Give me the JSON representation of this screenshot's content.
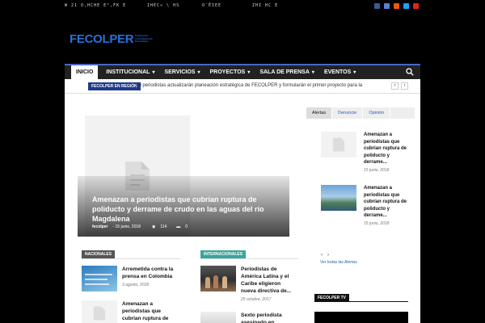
{
  "topbar": {
    "segments": [
      "W 21 O,HCHE E²,FK E",
      "IHEC« \\ HS",
      "O¯ÊIEE",
      "ZHI HC E"
    ]
  },
  "social_icons": [
    {
      "name": "facebook-icon",
      "color": "#3b5998"
    },
    {
      "name": "instagram-icon",
      "color": "#5b7fd1"
    },
    {
      "name": "soundcloud-icon",
      "color": "#ff5500"
    },
    {
      "name": "twitter-icon",
      "color": "#1da1f2"
    },
    {
      "name": "youtube-icon",
      "color": "#e62117"
    }
  ],
  "logo": {
    "word": "FECOLPER",
    "subtitle": "Federación Colombiana de Periodistas"
  },
  "nav": {
    "items": [
      {
        "label": "INICIO",
        "active": true,
        "dropdown": false
      },
      {
        "label": "INSTITUCIONAL",
        "active": false,
        "dropdown": true
      },
      {
        "label": "SERVICIOS",
        "active": false,
        "dropdown": true
      },
      {
        "label": "PROYECTOS",
        "active": false,
        "dropdown": true
      },
      {
        "label": "SALA DE PRENSA",
        "active": false,
        "dropdown": true
      },
      {
        "label": "EVENTOS",
        "active": false,
        "dropdown": true
      }
    ],
    "accent": "#4a66c8"
  },
  "ticker": {
    "badge": "FECOLPER EN REGIÓN",
    "headline": "20 periodistas actualizarán planeación estratégica de FECOLPER y formularán el primer proyecto para la",
    "prev": "‹",
    "next": "›"
  },
  "feature": {
    "title": "Amenazan a periodistas que cubrían ruptura de poliducto y derrame de crudo en las aguas del río Magdalena",
    "author": "fecolper",
    "date": "- 15 junio, 2018",
    "views": "114",
    "comments": "0"
  },
  "sections": {
    "nacionales": {
      "label": "NACIONALES",
      "color": "#555",
      "articles": [
        {
          "title": "Arremetida contra la prensa en Colombia",
          "date": "3 agosto, 2018"
        },
        {
          "title": "Amenazan a periodistas que cubrían ruptura de poliducto y",
          "date": ""
        }
      ]
    },
    "internacionales": {
      "label": "INTERNACIONALES",
      "color": "#3aa59a",
      "articles": [
        {
          "title": "Periodistas de América Latina y el Caribe eligieron nueva directiva de...",
          "date": "25 octubre, 2017"
        },
        {
          "title": "Sexto periodista asesinado en",
          "date": ""
        }
      ]
    }
  },
  "sidebar": {
    "tabs": [
      {
        "label": "Alertas",
        "active": true
      },
      {
        "label": "Denuncie",
        "active": false
      },
      {
        "label": "Opinión",
        "active": false
      }
    ],
    "items": [
      {
        "title": "Amenazan a periodistas que cubrían ruptura de poliducto y derrame...",
        "date": "15 junio, 2018"
      },
      {
        "title": "Amenazan a periodistas que cubrían ruptura de poliducto y derrame...",
        "date": "15 junio, 2018"
      }
    ],
    "prev": "‹",
    "next": "›",
    "view_all": "Ver todas las Alertas",
    "tv_label": "FECOLPER TV"
  }
}
